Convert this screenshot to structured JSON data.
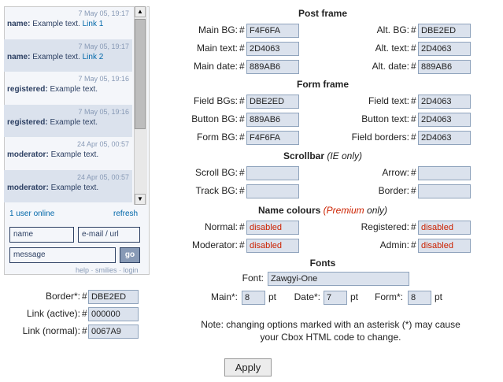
{
  "preview": {
    "messages": [
      {
        "date": "7 May 05, 19:17",
        "name": "name:",
        "text": "Example text.",
        "link": "Link 1"
      },
      {
        "date": "7 May 05, 19:17",
        "name": "name:",
        "text": "Example text.",
        "link": "Link 2"
      },
      {
        "date": "7 May 05, 19:16",
        "name": "registered:",
        "text": "Example text.",
        "link": ""
      },
      {
        "date": "7 May 05, 19:16",
        "name": "registered:",
        "text": "Example text.",
        "link": ""
      },
      {
        "date": "24 Apr 05, 00:57",
        "name": "moderator:",
        "text": "Example text.",
        "link": ""
      },
      {
        "date": "24 Apr 05, 00:57",
        "name": "moderator:",
        "text": "Example text.",
        "link": ""
      }
    ],
    "users_online": "1 user online",
    "refresh": "refresh",
    "name_placeholder": "name",
    "email_placeholder": "e-mail / url",
    "message_placeholder": "message",
    "go": "go",
    "help_links": "help · smilies · login"
  },
  "left_options": [
    {
      "label": "Border*:",
      "value": "DBE2ED"
    },
    {
      "label": "Link (active):",
      "value": "000000"
    },
    {
      "label": "Link (normal):",
      "value": "0067A9"
    }
  ],
  "hash": "#",
  "sections": {
    "post_frame": "Post frame",
    "form_frame": "Form frame",
    "scrollbar": "Scrollbar",
    "scrollbar_note": "(IE only)",
    "name_colours": "Name colours",
    "premium": "(Premium",
    "only": "only)",
    "fonts": "Fonts"
  },
  "post_frame": [
    {
      "label": "Main BG:",
      "value": "F4F6FA",
      "label2": "Alt. BG:",
      "value2": "DBE2ED"
    },
    {
      "label": "Main text:",
      "value": "2D4063",
      "label2": "Alt. text:",
      "value2": "2D4063"
    },
    {
      "label": "Main date:",
      "value": "889AB6",
      "label2": "Alt. date:",
      "value2": "889AB6"
    }
  ],
  "form_frame": [
    {
      "label": "Field BGs:",
      "value": "DBE2ED",
      "label2": "Field text:",
      "value2": "2D4063"
    },
    {
      "label": "Button BG:",
      "value": "889AB6",
      "label2": "Button text:",
      "value2": "2D4063"
    },
    {
      "label": "Form BG:",
      "value": "F4F6FA",
      "label2": "Field borders:",
      "value2": "2D4063"
    }
  ],
  "scrollbar": [
    {
      "label": "Scroll BG:",
      "value": "",
      "label2": "Arrow:",
      "value2": ""
    },
    {
      "label": "Track BG:",
      "value": "",
      "label2": "Border:",
      "value2": ""
    }
  ],
  "name_colours": [
    {
      "label": "Normal:",
      "value": "disabled",
      "label2": "Registered:",
      "value2": "disabled"
    },
    {
      "label": "Moderator:",
      "value": "disabled",
      "label2": "Admin:",
      "value2": "disabled"
    }
  ],
  "fonts": {
    "font_label": "Font:",
    "font_value": "Zawgyi-One",
    "main_label": "Main*:",
    "main_value": "8",
    "date_label": "Date*:",
    "date_value": "7",
    "form_label": "Form*:",
    "form_value": "8",
    "unit": "pt"
  },
  "note_line1": "Note: changing options marked with an asterisk (*) may cause",
  "note_line2": "your Cbox HTML code to change.",
  "apply": "Apply",
  "colors": {
    "accent": "#DBE2ED",
    "text": "#2D4063",
    "date": "#889AB6",
    "link": "#0067A9",
    "disabled": "#cc2200"
  }
}
